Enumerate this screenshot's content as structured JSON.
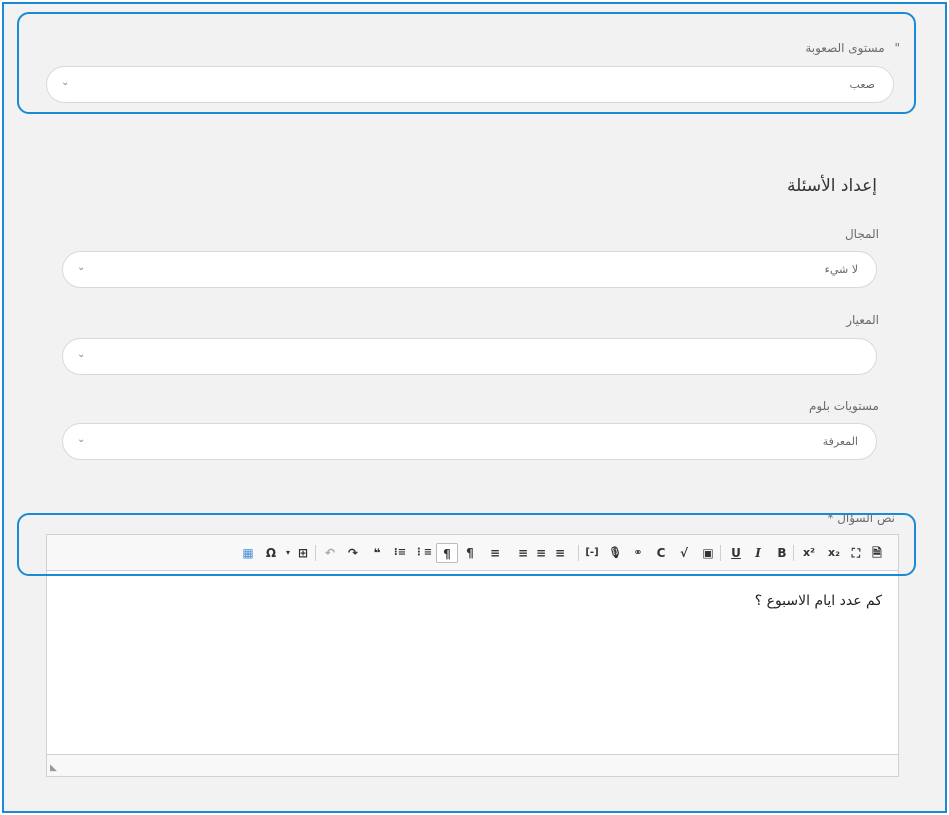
{
  "difficulty": {
    "label": "مستوى الصعوبة",
    "quote_mark": "\"",
    "value": "صعب"
  },
  "section_title": "إعداد الأسئلة",
  "domain_field": {
    "label": "المجال",
    "value": "لا شيء"
  },
  "standard_field": {
    "label": "المعيار",
    "value": ""
  },
  "bloom_field": {
    "label": "مستويات بلوم",
    "value": "المعرفة"
  },
  "question_text": {
    "label": "نص السؤال *",
    "content": "كم عدد ايام الاسبوع ؟"
  },
  "toolbar_icons": {
    "source": "🗎",
    "maximize": "⛶",
    "subscript": "x₂",
    "superscript": "x²",
    "bold": "B",
    "italic": "I",
    "underline": "U",
    "image": "▣",
    "math": "√",
    "copyright": "C",
    "link": "⚭",
    "mic": "🎙",
    "placeholder": "[-]",
    "align_right": "≡",
    "align_center": "≡",
    "align_left": "≡",
    "justify": "≡",
    "ltr": "¶",
    "rtl": "¶",
    "numbered_list": "⋮≡",
    "bulleted_list": "⁝≡",
    "blockquote": "❝",
    "redo": "↷",
    "undo": "↶",
    "table": "⊞",
    "special_char": "Ω",
    "templates": "▦"
  },
  "colors": {
    "accent": "#1a8ad4",
    "background": "#f2f2f2"
  }
}
